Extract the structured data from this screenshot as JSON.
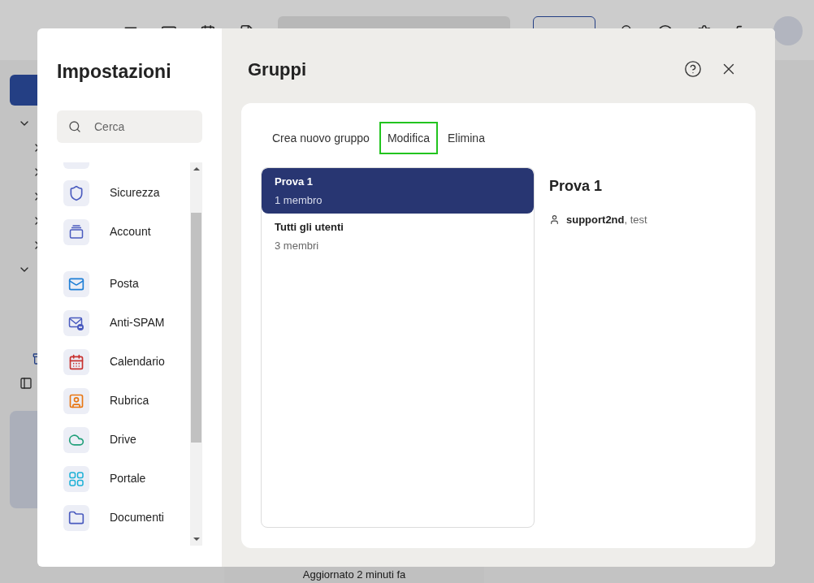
{
  "app": {
    "status": "Aggiornato 2 minuti fa"
  },
  "settings": {
    "title": "Impostazioni",
    "search": {
      "placeholder": "Cerca"
    },
    "sections": [
      {
        "items": [
          {
            "label": "Sicurezza",
            "color": "#4a5bbf"
          },
          {
            "label": "Account",
            "color": "#4a5bbf"
          }
        ]
      },
      {
        "items": [
          {
            "label": "Posta",
            "color": "#1f7fd6"
          },
          {
            "label": "Anti-SPAM",
            "color": "#4a5bbf"
          },
          {
            "label": "Calendario",
            "color": "#c8312f"
          },
          {
            "label": "Rubrica",
            "color": "#e87612"
          },
          {
            "label": "Drive",
            "color": "#21a07a"
          },
          {
            "label": "Portale",
            "color": "#1ab0d6"
          },
          {
            "label": "Documenti",
            "color": "#4a5bbf"
          }
        ]
      }
    ]
  },
  "page": {
    "title": "Gruppi",
    "actions": [
      {
        "label": "Crea nuovo gruppo",
        "highlighted": false
      },
      {
        "label": "Modifica",
        "highlighted": true
      },
      {
        "label": "Elimina",
        "highlighted": false
      }
    ],
    "groups": [
      {
        "name": "Prova 1",
        "members": "1 membro",
        "selected": true
      },
      {
        "name": "Tutti gli utenti",
        "members": "3 membri",
        "selected": false
      }
    ],
    "detail": {
      "title": "Prova 1",
      "members": "**support2nd**, test"
    }
  }
}
